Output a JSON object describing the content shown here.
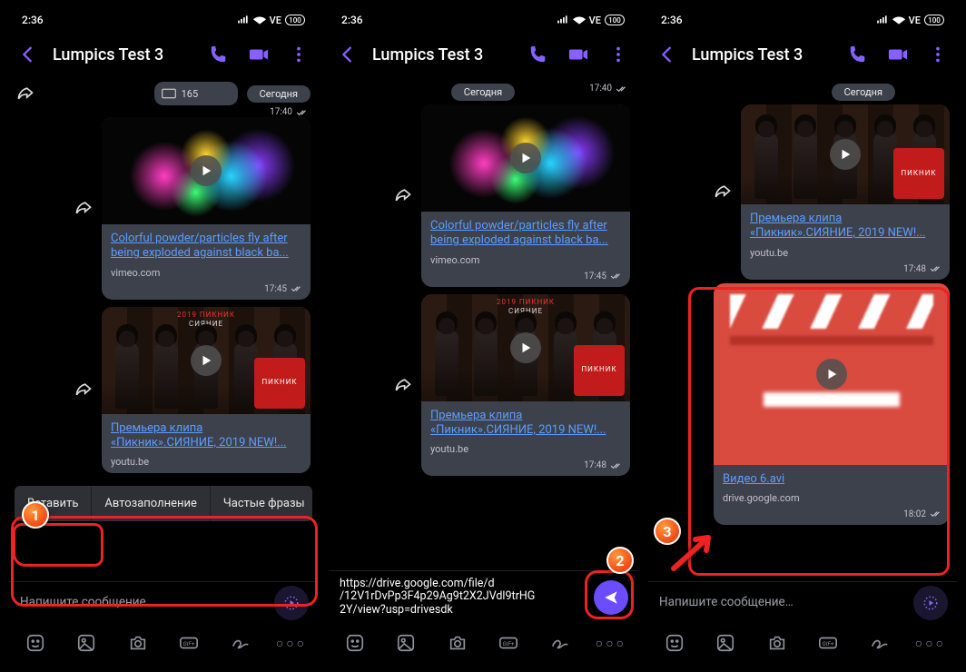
{
  "status": {
    "time": "2:36",
    "battery": "100"
  },
  "header": {
    "title": "Lumpics Test 3"
  },
  "chat": {
    "date_label": "Сегодня",
    "msg0": {
      "count": "165",
      "time": "17:40"
    },
    "msg1": {
      "link": "Colorful powder/particles fly after being exploded against black ba...",
      "domain": "vimeo.com",
      "time": "17:45"
    },
    "msg2": {
      "thumb_title": "2019 ПИКНИК",
      "thumb_sub": "СИЯНИЕ",
      "thumb_badge": "ПИКНИК",
      "link": "Премьера клипа «Пикник».СИЯНИЕ, 2019 NEW!...",
      "domain": "youtu.be",
      "time": "17:48"
    },
    "msg3": {
      "link": "Видео 6.avi",
      "domain": "drive.google.com",
      "time": "18:02"
    }
  },
  "context_menu": {
    "paste": "Вставить",
    "autofill": "Автозаполнение",
    "phrases": "Частые фразы"
  },
  "input": {
    "placeholder": "Напишите сообщение…",
    "typed_line1": "https://drive.google.com/file/d",
    "typed_line2": "/12V1rDvPp3F4p29Ag9t2X2JVdl9trHG",
    "typed_line3": "2Y/view?usp=drivesdk"
  },
  "steps": {
    "s1": "1",
    "s2": "2",
    "s3": "3"
  }
}
